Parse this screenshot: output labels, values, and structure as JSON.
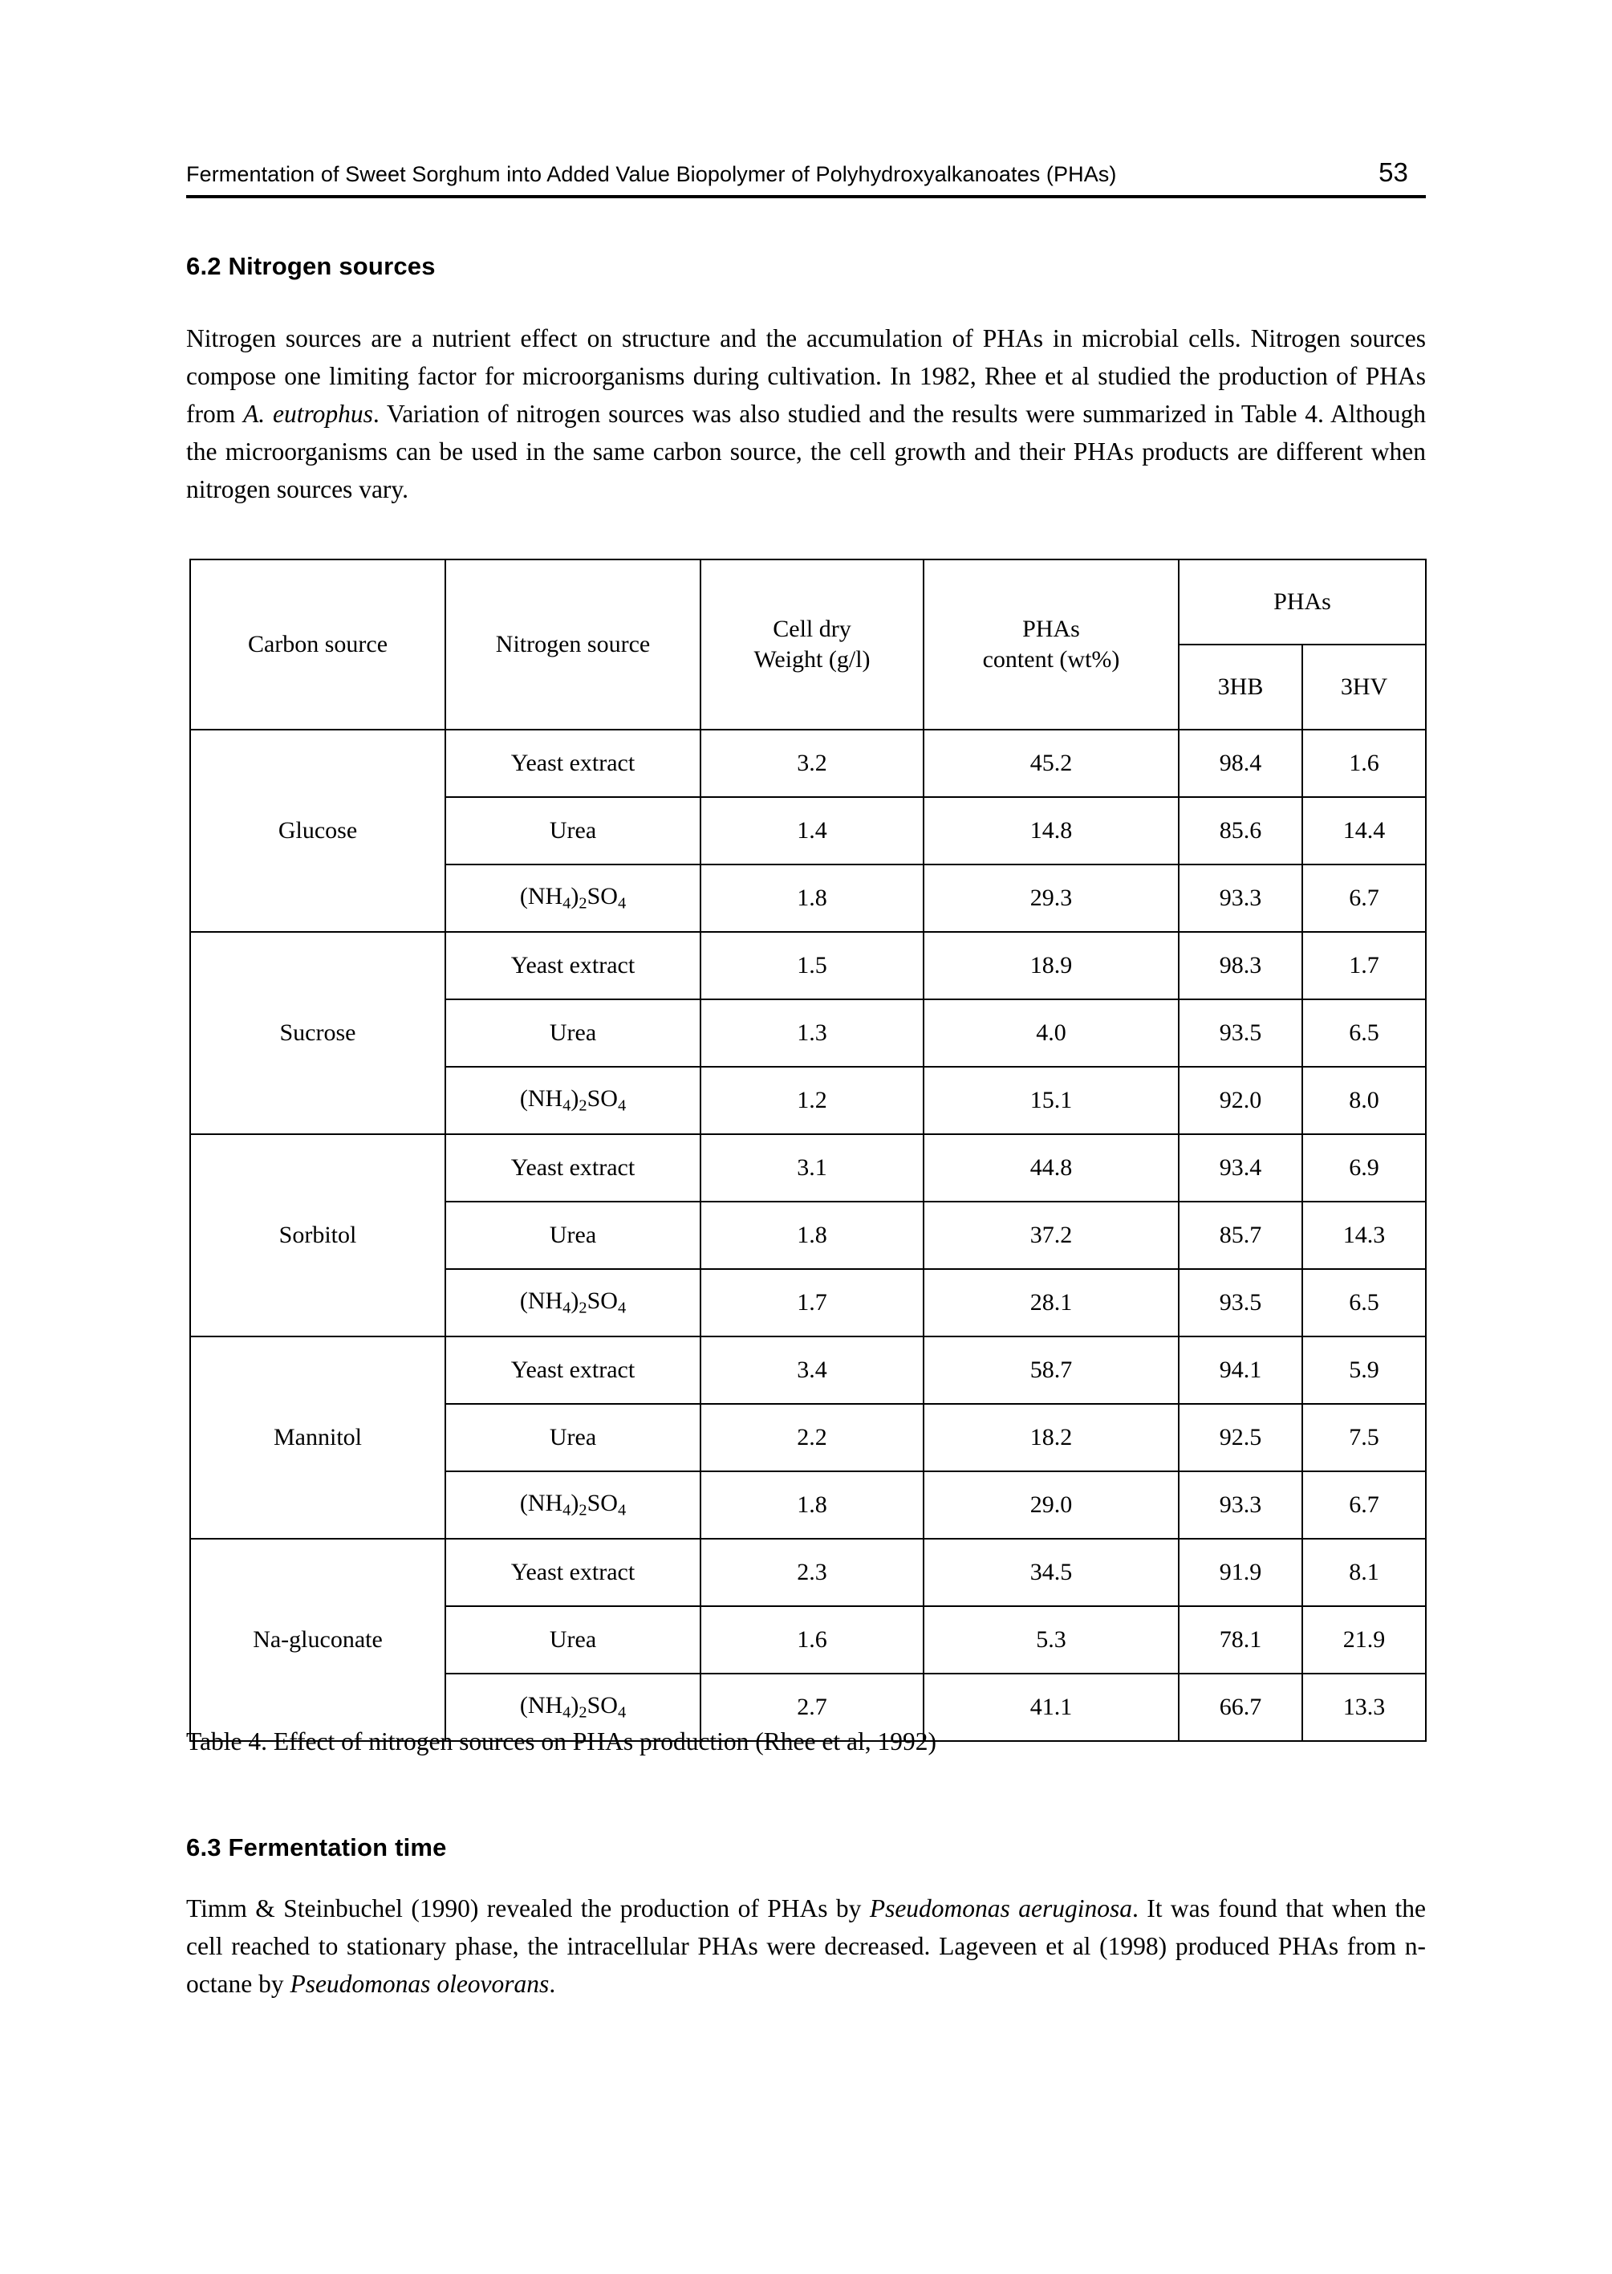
{
  "header": {
    "title": "Fermentation of Sweet Sorghum into Added Value Biopolymer of Polyhydroxyalkanoates (PHAs)",
    "page_number": "53"
  },
  "sections": {
    "nitrogen_sources": {
      "heading": "6.2 Nitrogen sources",
      "paragraph_plain": "Nitrogen sources are a nutrient effect on structure and the accumulation of PHAs in microbial cells. Nitrogen sources compose one limiting factor for microorganisms during cultivation. In 1982, Rhee et al studied the production of PHAs from A. eutrophus. Variation of nitrogen sources was also studied and the results were summarized in Table 4. Although the microorganisms can be used in the same carbon source, the cell growth and their PHAs products are different when nitrogen sources vary."
    },
    "fermentation_time": {
      "heading": "6.3 Fermentation time",
      "paragraph_plain": "Timm & Steinbuchel (1990) revealed the production of PHAs by Pseudomonas aeruginosa. It was found that when the cell reached to stationary phase, the intracellular PHAs were decreased. Lageveen et al (1998) produced PHAs from n-octane by Pseudomonas oleovorans."
    }
  },
  "table": {
    "caption": "Table 4. Effect of nitrogen sources on PHAs production (Rhee et al, 1992)",
    "headers": {
      "carbon_source": "Carbon source",
      "nitrogen_source": "Nitrogen source",
      "cell_dry_weight_line1": "Cell dry",
      "cell_dry_weight_line2": "Weight (g/l)",
      "phas_content_line1": "PHAs",
      "phas_content_line2": "content (wt%)",
      "phas_group": "PHAs",
      "phas_3hb": "3HB",
      "phas_3hv": "3HV"
    },
    "groups": [
      {
        "carbon_source": "Glucose",
        "rows": [
          {
            "nitrogen_source": "Yeast extract",
            "cell_dry_weight": "3.2",
            "phas_content": "45.2",
            "hb": "98.4",
            "hv": "1.6"
          },
          {
            "nitrogen_source": "Urea",
            "cell_dry_weight": "1.4",
            "phas_content": "14.8",
            "hb": "85.6",
            "hv": "14.4"
          },
          {
            "nitrogen_source": "(NH4)2SO4",
            "cell_dry_weight": "1.8",
            "phas_content": "29.3",
            "hb": "93.3",
            "hv": "6.7"
          }
        ]
      },
      {
        "carbon_source": "Sucrose",
        "rows": [
          {
            "nitrogen_source": "Yeast extract",
            "cell_dry_weight": "1.5",
            "phas_content": "18.9",
            "hb": "98.3",
            "hv": "1.7"
          },
          {
            "nitrogen_source": "Urea",
            "cell_dry_weight": "1.3",
            "phas_content": "4.0",
            "hb": "93.5",
            "hv": "6.5"
          },
          {
            "nitrogen_source": "(NH4)2SO4",
            "cell_dry_weight": "1.2",
            "phas_content": "15.1",
            "hb": "92.0",
            "hv": "8.0"
          }
        ]
      },
      {
        "carbon_source": "Sorbitol",
        "rows": [
          {
            "nitrogen_source": "Yeast extract",
            "cell_dry_weight": "3.1",
            "phas_content": "44.8",
            "hb": "93.4",
            "hv": "6.9"
          },
          {
            "nitrogen_source": "Urea",
            "cell_dry_weight": "1.8",
            "phas_content": "37.2",
            "hb": "85.7",
            "hv": "14.3"
          },
          {
            "nitrogen_source": "(NH4)2SO4",
            "cell_dry_weight": "1.7",
            "phas_content": "28.1",
            "hb": "93.5",
            "hv": "6.5"
          }
        ]
      },
      {
        "carbon_source": "Mannitol",
        "rows": [
          {
            "nitrogen_source": "Yeast extract",
            "cell_dry_weight": "3.4",
            "phas_content": "58.7",
            "hb": "94.1",
            "hv": "5.9"
          },
          {
            "nitrogen_source": "Urea",
            "cell_dry_weight": "2.2",
            "phas_content": "18.2",
            "hb": "92.5",
            "hv": "7.5"
          },
          {
            "nitrogen_source": "(NH4)2SO4",
            "cell_dry_weight": "1.8",
            "phas_content": "29.0",
            "hb": "93.3",
            "hv": "6.7"
          }
        ]
      },
      {
        "carbon_source": "Na-gluconate",
        "rows": [
          {
            "nitrogen_source": "Yeast extract",
            "cell_dry_weight": "2.3",
            "phas_content": "34.5",
            "hb": "91.9",
            "hv": "8.1"
          },
          {
            "nitrogen_source": "Urea",
            "cell_dry_weight": "1.6",
            "phas_content": "5.3",
            "hb": "78.1",
            "hv": "21.9"
          },
          {
            "nitrogen_source": "(NH4)2SO4",
            "cell_dry_weight": "2.7",
            "phas_content": "41.1",
            "hb": "66.7",
            "hv": "13.3"
          }
        ]
      }
    ]
  }
}
